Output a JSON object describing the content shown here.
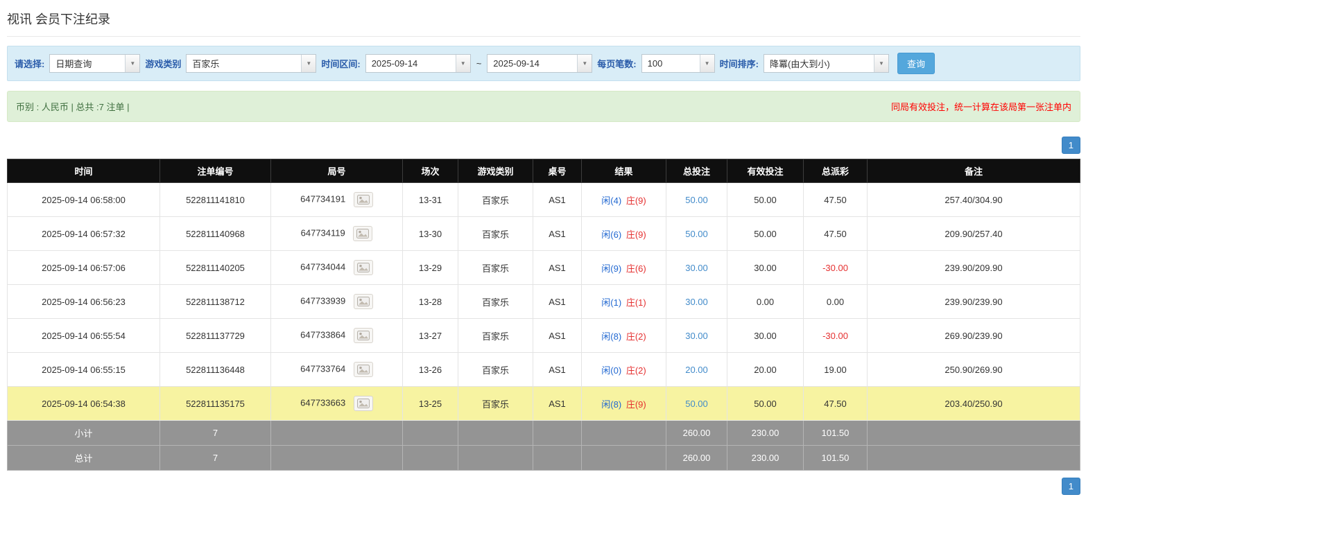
{
  "page": {
    "title": "视讯 会员下注纪录"
  },
  "filters": {
    "select_label": "请选择:",
    "select_value": "日期查询",
    "game_type_label": "游戏类别",
    "game_type_value": "百家乐",
    "time_range_label": "时间区间:",
    "date_from": "2025-09-14",
    "date_separator": "~",
    "date_to": "2025-09-14",
    "page_size_label": "每页笔数:",
    "page_size_value": "100",
    "sort_label": "时间排序:",
    "sort_value": "降冪(由大到小)",
    "query_button": "查询"
  },
  "summary": {
    "info": "币别 : 人民币 | 总共 :7 注单 |",
    "notice": "同局有效投注，统一计算在该局第一张注单内"
  },
  "pagination": {
    "page": "1"
  },
  "colors": {
    "filter_bar_bg": "#d9edf7",
    "summary_bar_bg": "#dff0d8",
    "notice_red": "#ff0000",
    "accent_blue": "#428bca",
    "query_button_blue": "#54a7dc",
    "header_black": "#0f0f0f",
    "footer_gray": "#949494",
    "highlight_yellow": "#f7f3a1",
    "player_blue": "#2268d1",
    "banker_red": "#e53030",
    "negative_red": "#e53030"
  },
  "table": {
    "headers": [
      "时间",
      "注单编号",
      "局号",
      "场次",
      "游戏类别",
      "桌号",
      "结果",
      "总投注",
      "有效投注",
      "总派彩",
      "备注"
    ],
    "rows": [
      {
        "time": "2025-09-14 06:58:00",
        "bet_id": "522811141810",
        "round_id": "647734191",
        "session": "13-31",
        "game_type": "百家乐",
        "table_no": "AS1",
        "result_player": "闲(4)",
        "result_banker": "庄(9)",
        "total_bet": "50.00",
        "valid_bet": "50.00",
        "payout": "47.50",
        "remark": "257.40/304.90",
        "highlighted": false
      },
      {
        "time": "2025-09-14 06:57:32",
        "bet_id": "522811140968",
        "round_id": "647734119",
        "session": "13-30",
        "game_type": "百家乐",
        "table_no": "AS1",
        "result_player": "闲(6)",
        "result_banker": "庄(9)",
        "total_bet": "50.00",
        "valid_bet": "50.00",
        "payout": "47.50",
        "remark": "209.90/257.40",
        "highlighted": false
      },
      {
        "time": "2025-09-14 06:57:06",
        "bet_id": "522811140205",
        "round_id": "647734044",
        "session": "13-29",
        "game_type": "百家乐",
        "table_no": "AS1",
        "result_player": "闲(9)",
        "result_banker": "庄(6)",
        "total_bet": "30.00",
        "valid_bet": "30.00",
        "payout": "-30.00",
        "remark": "239.90/209.90",
        "highlighted": false
      },
      {
        "time": "2025-09-14 06:56:23",
        "bet_id": "522811138712",
        "round_id": "647733939",
        "session": "13-28",
        "game_type": "百家乐",
        "table_no": "AS1",
        "result_player": "闲(1)",
        "result_banker": "庄(1)",
        "total_bet": "30.00",
        "valid_bet": "0.00",
        "payout": "0.00",
        "remark": "239.90/239.90",
        "highlighted": false
      },
      {
        "time": "2025-09-14 06:55:54",
        "bet_id": "522811137729",
        "round_id": "647733864",
        "session": "13-27",
        "game_type": "百家乐",
        "table_no": "AS1",
        "result_player": "闲(8)",
        "result_banker": "庄(2)",
        "total_bet": "30.00",
        "valid_bet": "30.00",
        "payout": "-30.00",
        "remark": "269.90/239.90",
        "highlighted": false
      },
      {
        "time": "2025-09-14 06:55:15",
        "bet_id": "522811136448",
        "round_id": "647733764",
        "session": "13-26",
        "game_type": "百家乐",
        "table_no": "AS1",
        "result_player": "闲(0)",
        "result_banker": "庄(2)",
        "total_bet": "20.00",
        "valid_bet": "20.00",
        "payout": "19.00",
        "remark": "250.90/269.90",
        "highlighted": false
      },
      {
        "time": "2025-09-14 06:54:38",
        "bet_id": "522811135175",
        "round_id": "647733663",
        "session": "13-25",
        "game_type": "百家乐",
        "table_no": "AS1",
        "result_player": "闲(8)",
        "result_banker": "庄(9)",
        "total_bet": "50.00",
        "valid_bet": "50.00",
        "payout": "47.50",
        "remark": "203.40/250.90",
        "highlighted": true
      }
    ],
    "subtotal": {
      "label": "小计",
      "count": "7",
      "total_bet": "260.00",
      "valid_bet": "230.00",
      "payout": "101.50"
    },
    "total": {
      "label": "总计",
      "count": "7",
      "total_bet": "260.00",
      "valid_bet": "230.00",
      "payout": "101.50"
    }
  }
}
